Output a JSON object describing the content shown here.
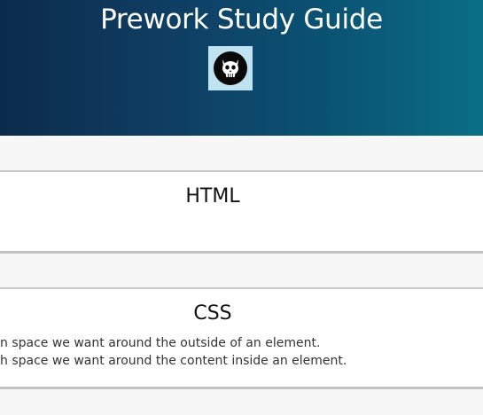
{
  "header": {
    "title": "Prework Study Guide",
    "logo_icon": "cat-skull-logo-icon"
  },
  "sections": [
    {
      "title": "HTML",
      "lines": []
    },
    {
      "title": "CSS",
      "lines": [
        "n space we want around the outside of an element.",
        "h space we want around the content inside an element."
      ]
    }
  ],
  "colors": {
    "header_gradient_start": "#0b2b4a",
    "header_gradient_end": "#0a6e87",
    "logo_background": "#bfe3f0",
    "page_background": "#f7f7f7"
  }
}
